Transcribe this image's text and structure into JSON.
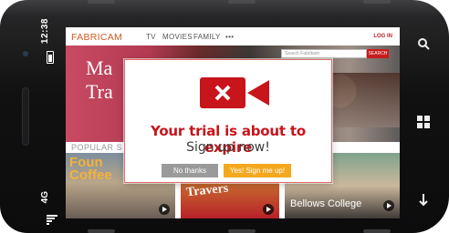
{
  "status_bar": {
    "time": "12:38",
    "network": "4G"
  },
  "website": {
    "logo": "FABRICAM",
    "nav": [
      "TV",
      "MOVIES",
      "FAMILY",
      "•••"
    ],
    "login": "LOG IN",
    "search_placeholder": "Search Fabrikam",
    "search_button": "SEARCH",
    "hero_text": [
      "Ma",
      "Tra"
    ],
    "section_label": "POPULAR S",
    "thumbnails": [
      {
        "text": "Foun\nCoffee"
      },
      {
        "text": "Travers"
      },
      {
        "text": "Bellows College"
      }
    ]
  },
  "modal": {
    "title": "Your trial is about to expire",
    "subtitle": "Sign up now!",
    "decline_label": "No thanks",
    "accept_label": "Yes! Sign me up!",
    "colors": {
      "brand_red": "#c8141b",
      "accept": "#f4a81d",
      "decline": "#9a9a9a"
    }
  },
  "hardware_keys": [
    "search-icon",
    "windows-icon",
    "back-icon"
  ]
}
